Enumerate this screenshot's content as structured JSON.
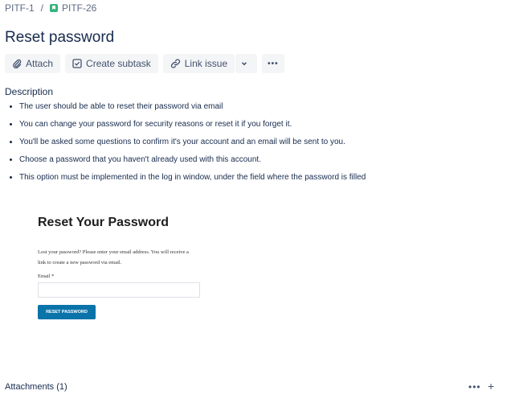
{
  "breadcrumb": {
    "parent": "PITF-1",
    "separator": "/",
    "current": "PITF-26"
  },
  "issue": {
    "title": "Reset password"
  },
  "toolbar": {
    "attach": "Attach",
    "create_subtask": "Create subtask",
    "link_issue": "Link issue",
    "more": "•••"
  },
  "description": {
    "label": "Description",
    "items": [
      "The user should be able to reset their password via email",
      "You can change your password for security reasons or reset it if you forget it.",
      "You'll be asked some questions to confirm it's your account and an email will be sent to you.",
      "Choose a password that you haven't already used with this account.",
      "This option must be implemented in the log in window, under the field where the password is filled"
    ]
  },
  "embedded_image": {
    "heading": "Reset Your Password",
    "text": "Lost your password? Please enter your email address. You will receive a link to create a new password via email.",
    "email_label": "Email *",
    "button": "RESET PASSWORD"
  },
  "attachments": {
    "label": "Attachments (1)",
    "more": "•••",
    "add": "+"
  },
  "colors": {
    "text": "#172b4d",
    "muted": "#5e6c84",
    "button_bg": "#f4f5f7",
    "story": "#36b37e",
    "embed_button": "#0a73aa"
  },
  "icons": [
    "story-icon",
    "paperclip-icon",
    "subtask-icon",
    "link-icon",
    "chevron-down-icon",
    "more-icon",
    "plus-icon"
  ]
}
